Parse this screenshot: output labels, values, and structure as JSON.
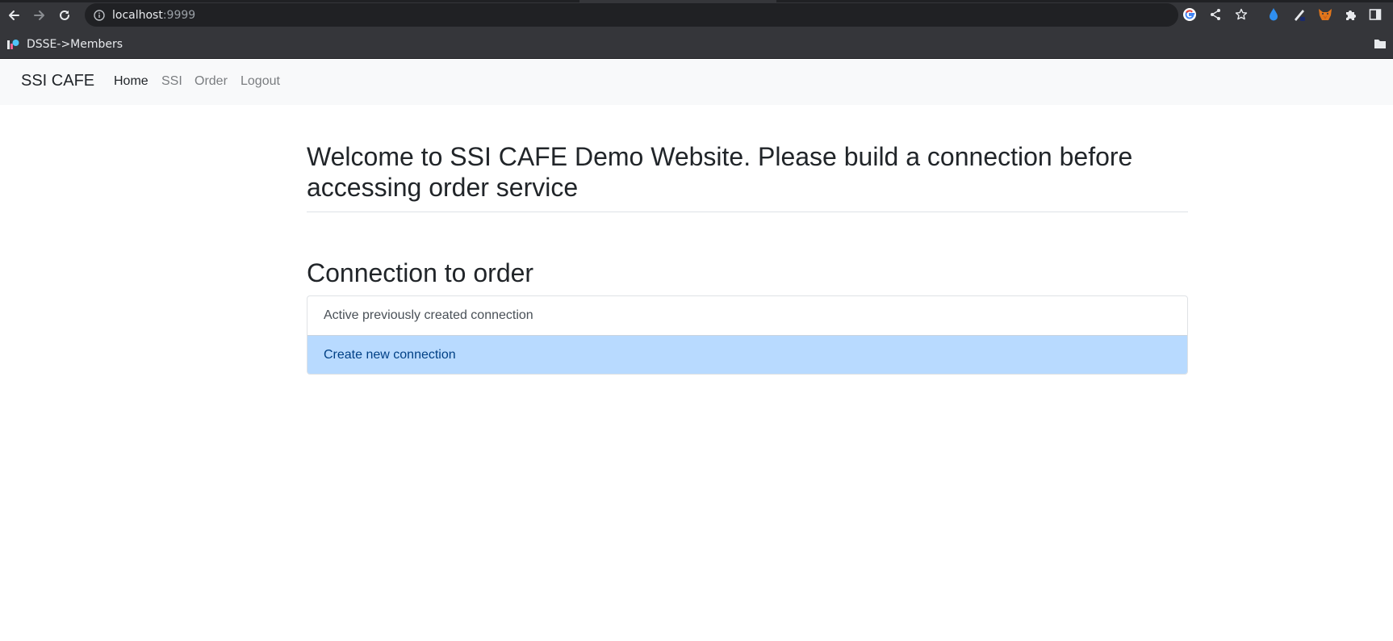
{
  "browser": {
    "url_host": "localhost",
    "url_port": ":9999",
    "bookmarks": [
      {
        "label": "DSSE->Members"
      }
    ],
    "icons": {
      "back": "arrow-left-icon",
      "forward": "arrow-right-icon",
      "reload": "reload-icon",
      "info": "info-icon",
      "google": "google-icon",
      "share": "share-icon",
      "bookmark_star": "star-icon",
      "extension_drop": "water-drop-icon",
      "extension_pen": "pen-icon",
      "extension_fox": "fox-icon",
      "extensions": "puzzle-icon",
      "side_panel": "side-panel-icon",
      "other_bookmarks": "folder-icon"
    }
  },
  "navbar": {
    "brand": "SSI CAFE",
    "links": [
      {
        "label": "Home",
        "active": true
      },
      {
        "label": "SSI",
        "active": false
      },
      {
        "label": "Order",
        "active": false
      },
      {
        "label": "Logout",
        "active": false
      }
    ]
  },
  "main": {
    "welcome_heading": "Welcome to SSI CAFE Demo Website. Please build a connection before accessing order service",
    "connection_heading": "Connection to order",
    "options": [
      {
        "label": "Active previously created connection",
        "style": "default"
      },
      {
        "label": "Create new connection",
        "style": "primary"
      }
    ]
  },
  "colors": {
    "chrome_bg": "#35363a",
    "omnibox_bg": "#202124",
    "navbar_bg": "#f8f9fa",
    "primary_item_bg": "#b8daff",
    "primary_item_text": "#004085"
  }
}
